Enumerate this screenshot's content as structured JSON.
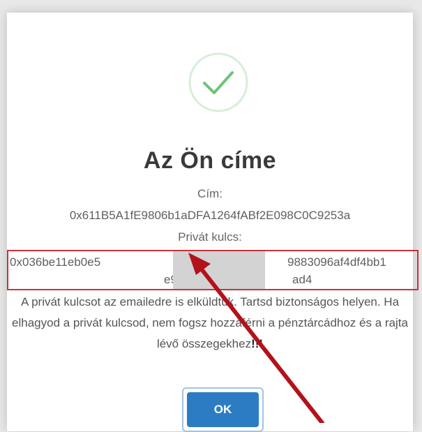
{
  "dialog": {
    "title": "Az Ön címe",
    "address_label": "Cím:",
    "address_value": "0x611B5A1fE9806b1aDFA1264fABf2E098C0C9253a",
    "private_key_label": "Privát kulcs:",
    "private_key_line1_start": "0x036be11eb0e5",
    "private_key_line1_end": "9883096af4df4bb1",
    "private_key_line2_start": "e9",
    "private_key_line2_end": "ad4",
    "notice_text": "A privát kulcsot az emailedre is elküldtük. Tartsd biztonságos helyen. Ha elhagyod a privát kulcsod, nem fogsz hozzáférni a pénztárcádhoz és a rajta lévő összegekhez",
    "notice_emphasis": "!!!",
    "ok_label": "OK"
  },
  "icons": {
    "success": "check-circle-icon",
    "annotation": "red-arrow-icon"
  },
  "colors": {
    "check": "#6fc27a",
    "highlight_border": "#c9333a",
    "button": "#2c7cc3",
    "arrow": "#b3121b",
    "redaction": "#d3d3d3"
  }
}
